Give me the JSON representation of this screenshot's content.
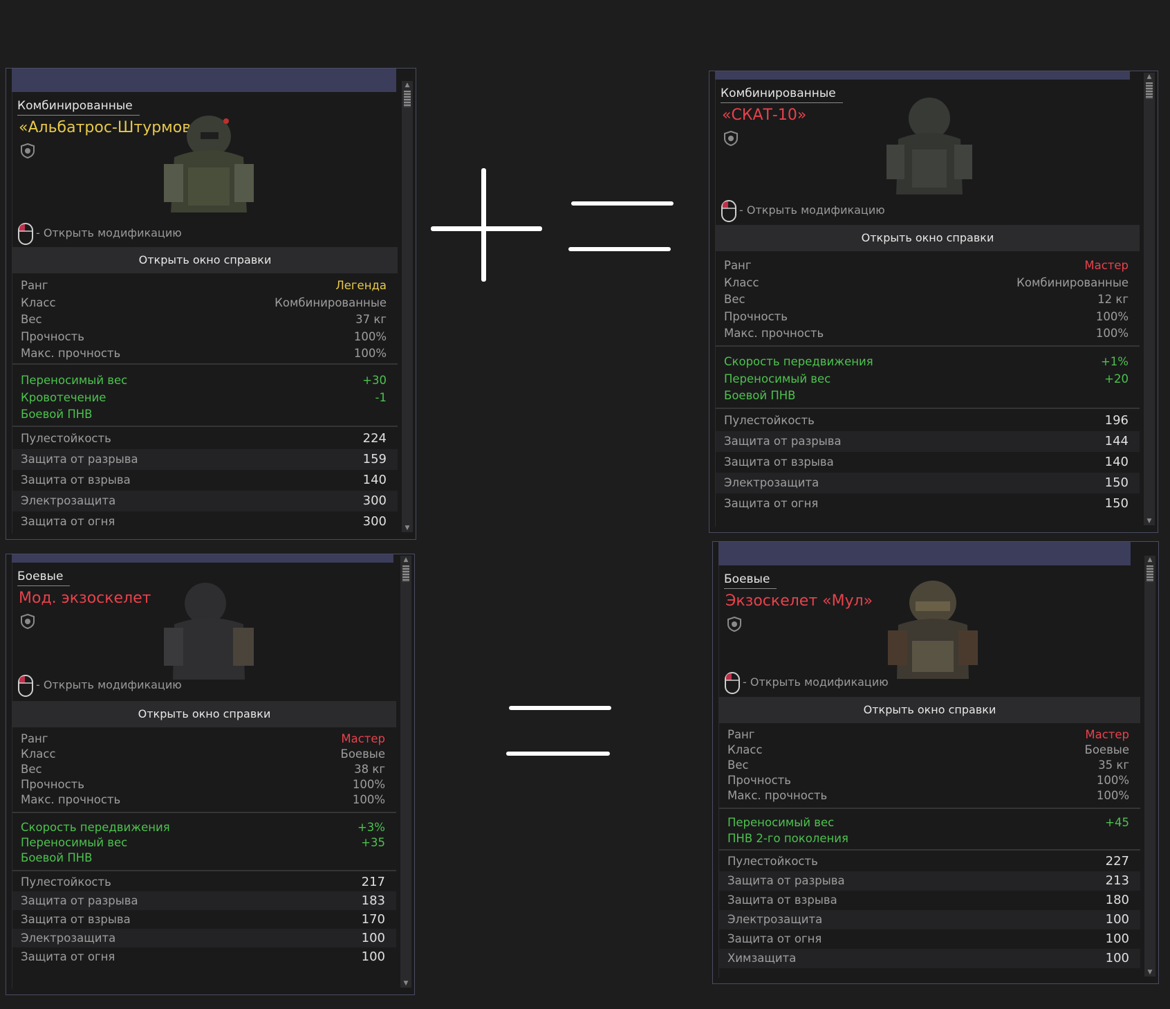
{
  "labels": {
    "open_mod": "- Открыть модификацию",
    "open_help": "Открыть окно справки",
    "stat_rank": "Ранг",
    "stat_class": "Класс",
    "stat_weight": "Вес",
    "stat_durability": "Прочность",
    "stat_max_durability": "Макс. прочность"
  },
  "cards": [
    {
      "category": "Комбинированные",
      "name": "«Альбатрос-Штурмовик»",
      "name_color": "#e8c94a",
      "rank": "Легенда",
      "rank_color": "#e8c94a",
      "class": "Комбинированные",
      "weight": "37 кг",
      "durability": "100%",
      "max_durability": "100%",
      "bonuses": [
        {
          "label": "Переносимый вес",
          "value": "+30"
        },
        {
          "label": "Кровотечение",
          "value": "-1"
        },
        {
          "label": "Боевой ПНВ",
          "value": ""
        }
      ],
      "protection": [
        {
          "label": "Пулестойкость",
          "value": "224"
        },
        {
          "label": "Защита от разрыва",
          "value": "159"
        },
        {
          "label": "Защита от взрыва",
          "value": "140"
        },
        {
          "label": "Электрозащита",
          "value": "300"
        },
        {
          "label": "Защита от огня",
          "value": "300"
        }
      ]
    },
    {
      "category": "Комбинированные",
      "name": "«СКАТ-10»",
      "name_color": "#e8424a",
      "rank": "Мастер",
      "rank_color": "#e8424a",
      "class": "Комбинированные",
      "weight": "12 кг",
      "durability": "100%",
      "max_durability": "100%",
      "bonuses": [
        {
          "label": "Скорость передвижения",
          "value": "+1%"
        },
        {
          "label": "Переносимый вес",
          "value": "+20"
        },
        {
          "label": "Боевой ПНВ",
          "value": ""
        }
      ],
      "protection": [
        {
          "label": "Пулестойкость",
          "value": "196"
        },
        {
          "label": "Защита от разрыва",
          "value": "144"
        },
        {
          "label": "Защита от взрыва",
          "value": "140"
        },
        {
          "label": "Электрозащита",
          "value": "150"
        },
        {
          "label": "Защита от огня",
          "value": "150"
        }
      ]
    },
    {
      "category": "Боевые",
      "name": "Мод. экзоскелет",
      "name_color": "#e8424a",
      "rank": "Мастер",
      "rank_color": "#e8424a",
      "class": "Боевые",
      "weight": "38 кг",
      "durability": "100%",
      "max_durability": "100%",
      "bonuses": [
        {
          "label": "Скорость передвижения",
          "value": "+3%"
        },
        {
          "label": "Переносимый вес",
          "value": "+35"
        },
        {
          "label": "Боевой ПНВ",
          "value": ""
        }
      ],
      "protection": [
        {
          "label": "Пулестойкость",
          "value": "217"
        },
        {
          "label": "Защита от разрыва",
          "value": "183"
        },
        {
          "label": "Защита от взрыва",
          "value": "170"
        },
        {
          "label": "Электрозащита",
          "value": "100"
        },
        {
          "label": "Защита от огня",
          "value": "100"
        }
      ]
    },
    {
      "category": "Боевые",
      "name": "Экзоскелет «Мул»",
      "name_color": "#e8424a",
      "rank": "Мастер",
      "rank_color": "#e8424a",
      "class": "Боевые",
      "weight": "35 кг",
      "durability": "100%",
      "max_durability": "100%",
      "bonuses": [
        {
          "label": "Переносимый вес",
          "value": "+45"
        },
        {
          "label": "ПНВ 2-го поколения",
          "value": ""
        }
      ],
      "protection": [
        {
          "label": "Пулестойкость",
          "value": "227"
        },
        {
          "label": "Защита от разрыва",
          "value": "213"
        },
        {
          "label": "Защита от взрыва",
          "value": "180"
        },
        {
          "label": "Электрозащита",
          "value": "100"
        },
        {
          "label": "Защита от огня",
          "value": "100"
        },
        {
          "label": "Химзащита",
          "value": "100"
        }
      ]
    }
  ],
  "icons": {
    "plus": "plus-icon",
    "equals": "equals-icon",
    "shield": "shield-icon",
    "mouse": "mouse-icon"
  }
}
